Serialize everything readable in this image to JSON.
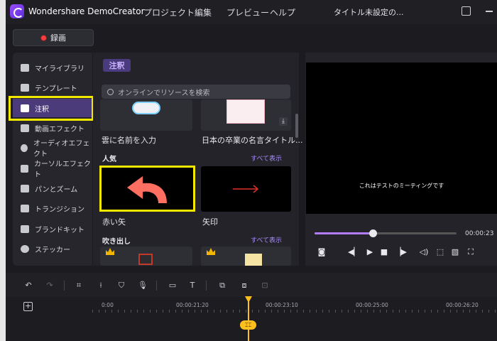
{
  "app": {
    "name": "Wondershare DemoCreator",
    "menu": [
      "プロジェクト",
      "編集",
      "プレビュー",
      "ヘルプ"
    ],
    "doc_title": "タイトル未設定の..."
  },
  "record": {
    "label": "録画"
  },
  "sidebar": {
    "items": [
      {
        "label": "マイライブラリ",
        "icon": "stack-icon"
      },
      {
        "label": "テンプレート",
        "icon": "template-icon"
      },
      {
        "label": "注釈",
        "icon": "annotation-icon",
        "active": true
      },
      {
        "label": "動画エフェクト",
        "icon": "video-effect-icon"
      },
      {
        "label": "オーディオエフェクト",
        "icon": "audio-effect-icon"
      },
      {
        "label": "カーソルエフェクト",
        "icon": "cursor-effect-icon"
      },
      {
        "label": "パンとズーム",
        "icon": "pan-zoom-icon"
      },
      {
        "label": "トランジション",
        "icon": "transition-icon"
      },
      {
        "label": "ブランドキット",
        "icon": "brand-kit-icon"
      },
      {
        "label": "ステッカー",
        "icon": "sticker-icon"
      }
    ]
  },
  "panel": {
    "tag": "注釈",
    "search_placeholder": "オンラインでリソースを検索",
    "top_items": [
      {
        "caption": "雲に名前を入力"
      },
      {
        "caption": "日本の卒業の名言タイトル..."
      }
    ],
    "sections": [
      {
        "title": "人気",
        "see_all": "すべて表示",
        "items": [
          {
            "caption": "赤い矢"
          },
          {
            "caption": "矢印"
          }
        ]
      },
      {
        "title": "吹き出し",
        "see_all": "すべて表示",
        "items": []
      }
    ]
  },
  "preview": {
    "caption_text": "これはテストのミーティングです",
    "current_time": "00:00:23",
    "progress": 0.41
  },
  "timeline": {
    "ticks": [
      "0:00",
      "00:00:21:20",
      "00:00:23:10",
      "00:00:25:00",
      "00:00:26:20"
    ]
  },
  "colors": {
    "accent": "#a98bff",
    "record_red": "#ff3b3b",
    "highlight_yellow": "#f3e800",
    "playhead": "#ffbf1f"
  }
}
